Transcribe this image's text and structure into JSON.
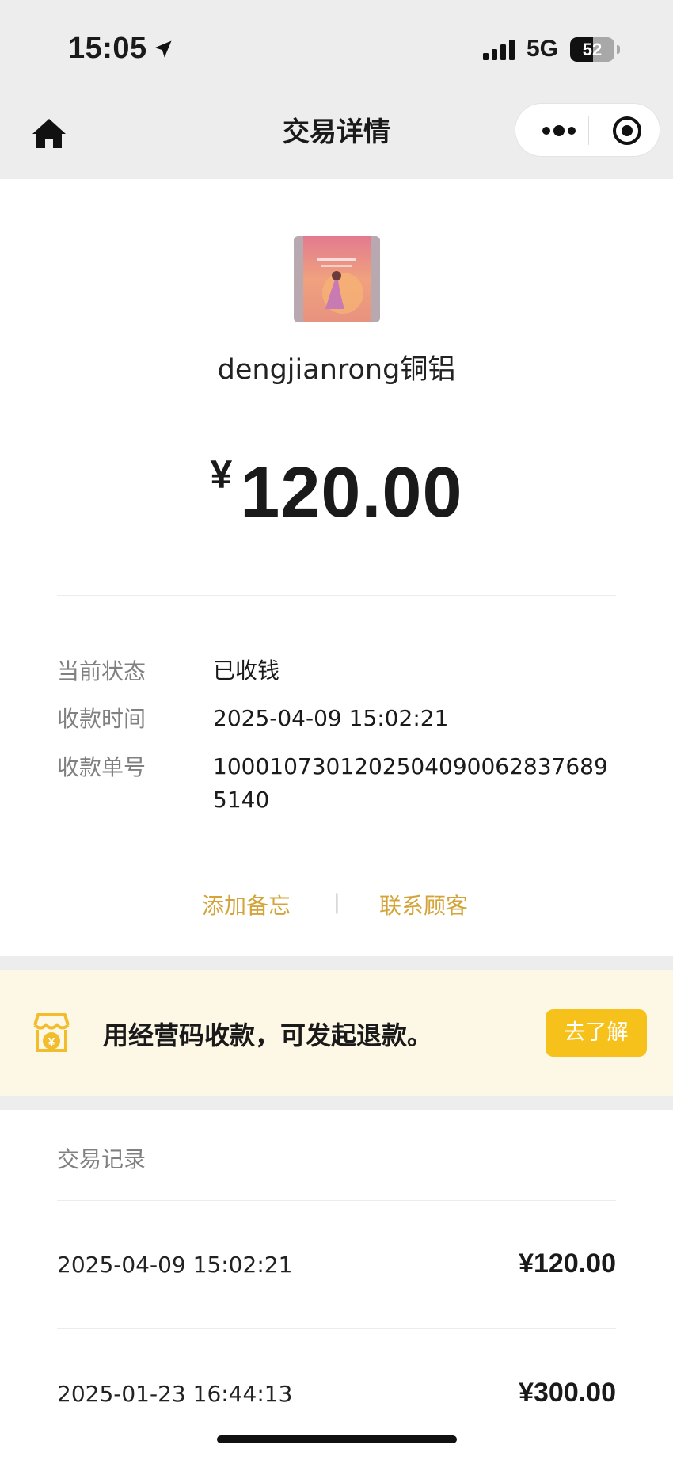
{
  "status_bar": {
    "time": "15:05",
    "network": "5G",
    "battery_level": "52",
    "battery_fraction": 0.52
  },
  "nav": {
    "title": "交易详情",
    "icons": [
      "home-icon",
      "more-dots-icon",
      "close-target-icon"
    ]
  },
  "merchant": {
    "name": "dengjianrong铜铝"
  },
  "amount": {
    "currency": "¥",
    "value": "120.00"
  },
  "info": [
    {
      "label": "当前状态",
      "value": "已收钱"
    },
    {
      "label": "收款时间",
      "value": "2025-04-09 15:02:21"
    },
    {
      "label": "收款单号",
      "value": "10001073012025040900628376895140"
    }
  ],
  "actions": {
    "add_note": "添加备忘",
    "separator": "|",
    "contact": "联系顾客"
  },
  "banner": {
    "text": "用经营码收款，可发起退款。",
    "button": "去了解"
  },
  "records": {
    "title": "交易记录",
    "items": [
      {
        "date": "2025-04-09 15:02:21",
        "amount": "¥120.00"
      },
      {
        "date": "2025-01-23 16:44:13",
        "amount": "¥300.00"
      }
    ]
  },
  "colors": {
    "accent_gold": "#d4a43a",
    "button_yellow": "#f6c11a",
    "banner_bg": "#fdf7e5",
    "header_bg": "#ededed"
  }
}
